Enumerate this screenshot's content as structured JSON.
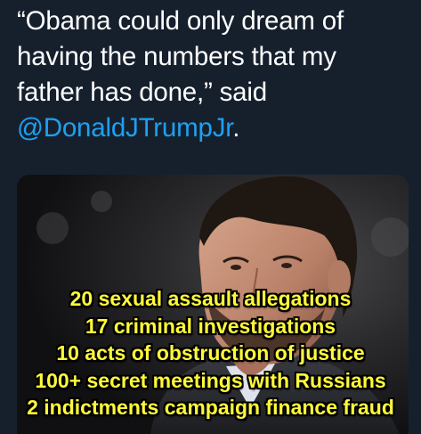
{
  "tweet": {
    "quote_open": "“",
    "quote_text": "Obama could only dream of having the numbers that my father has done,”",
    "said": " said ",
    "mention": "@DonaldJTrumpJr",
    "period": "."
  },
  "meme": {
    "caption_lines": [
      "20 sexual assault allegations",
      "17 criminal investigations",
      "10 acts of obstruction of justice",
      "100+ secret meetings with Russians",
      "2 indictments campaign finance fraud"
    ],
    "caption_color": "#fff93a"
  },
  "colors": {
    "background": "#16202d",
    "text": "#ffffff",
    "mention": "#1da1f2"
  }
}
